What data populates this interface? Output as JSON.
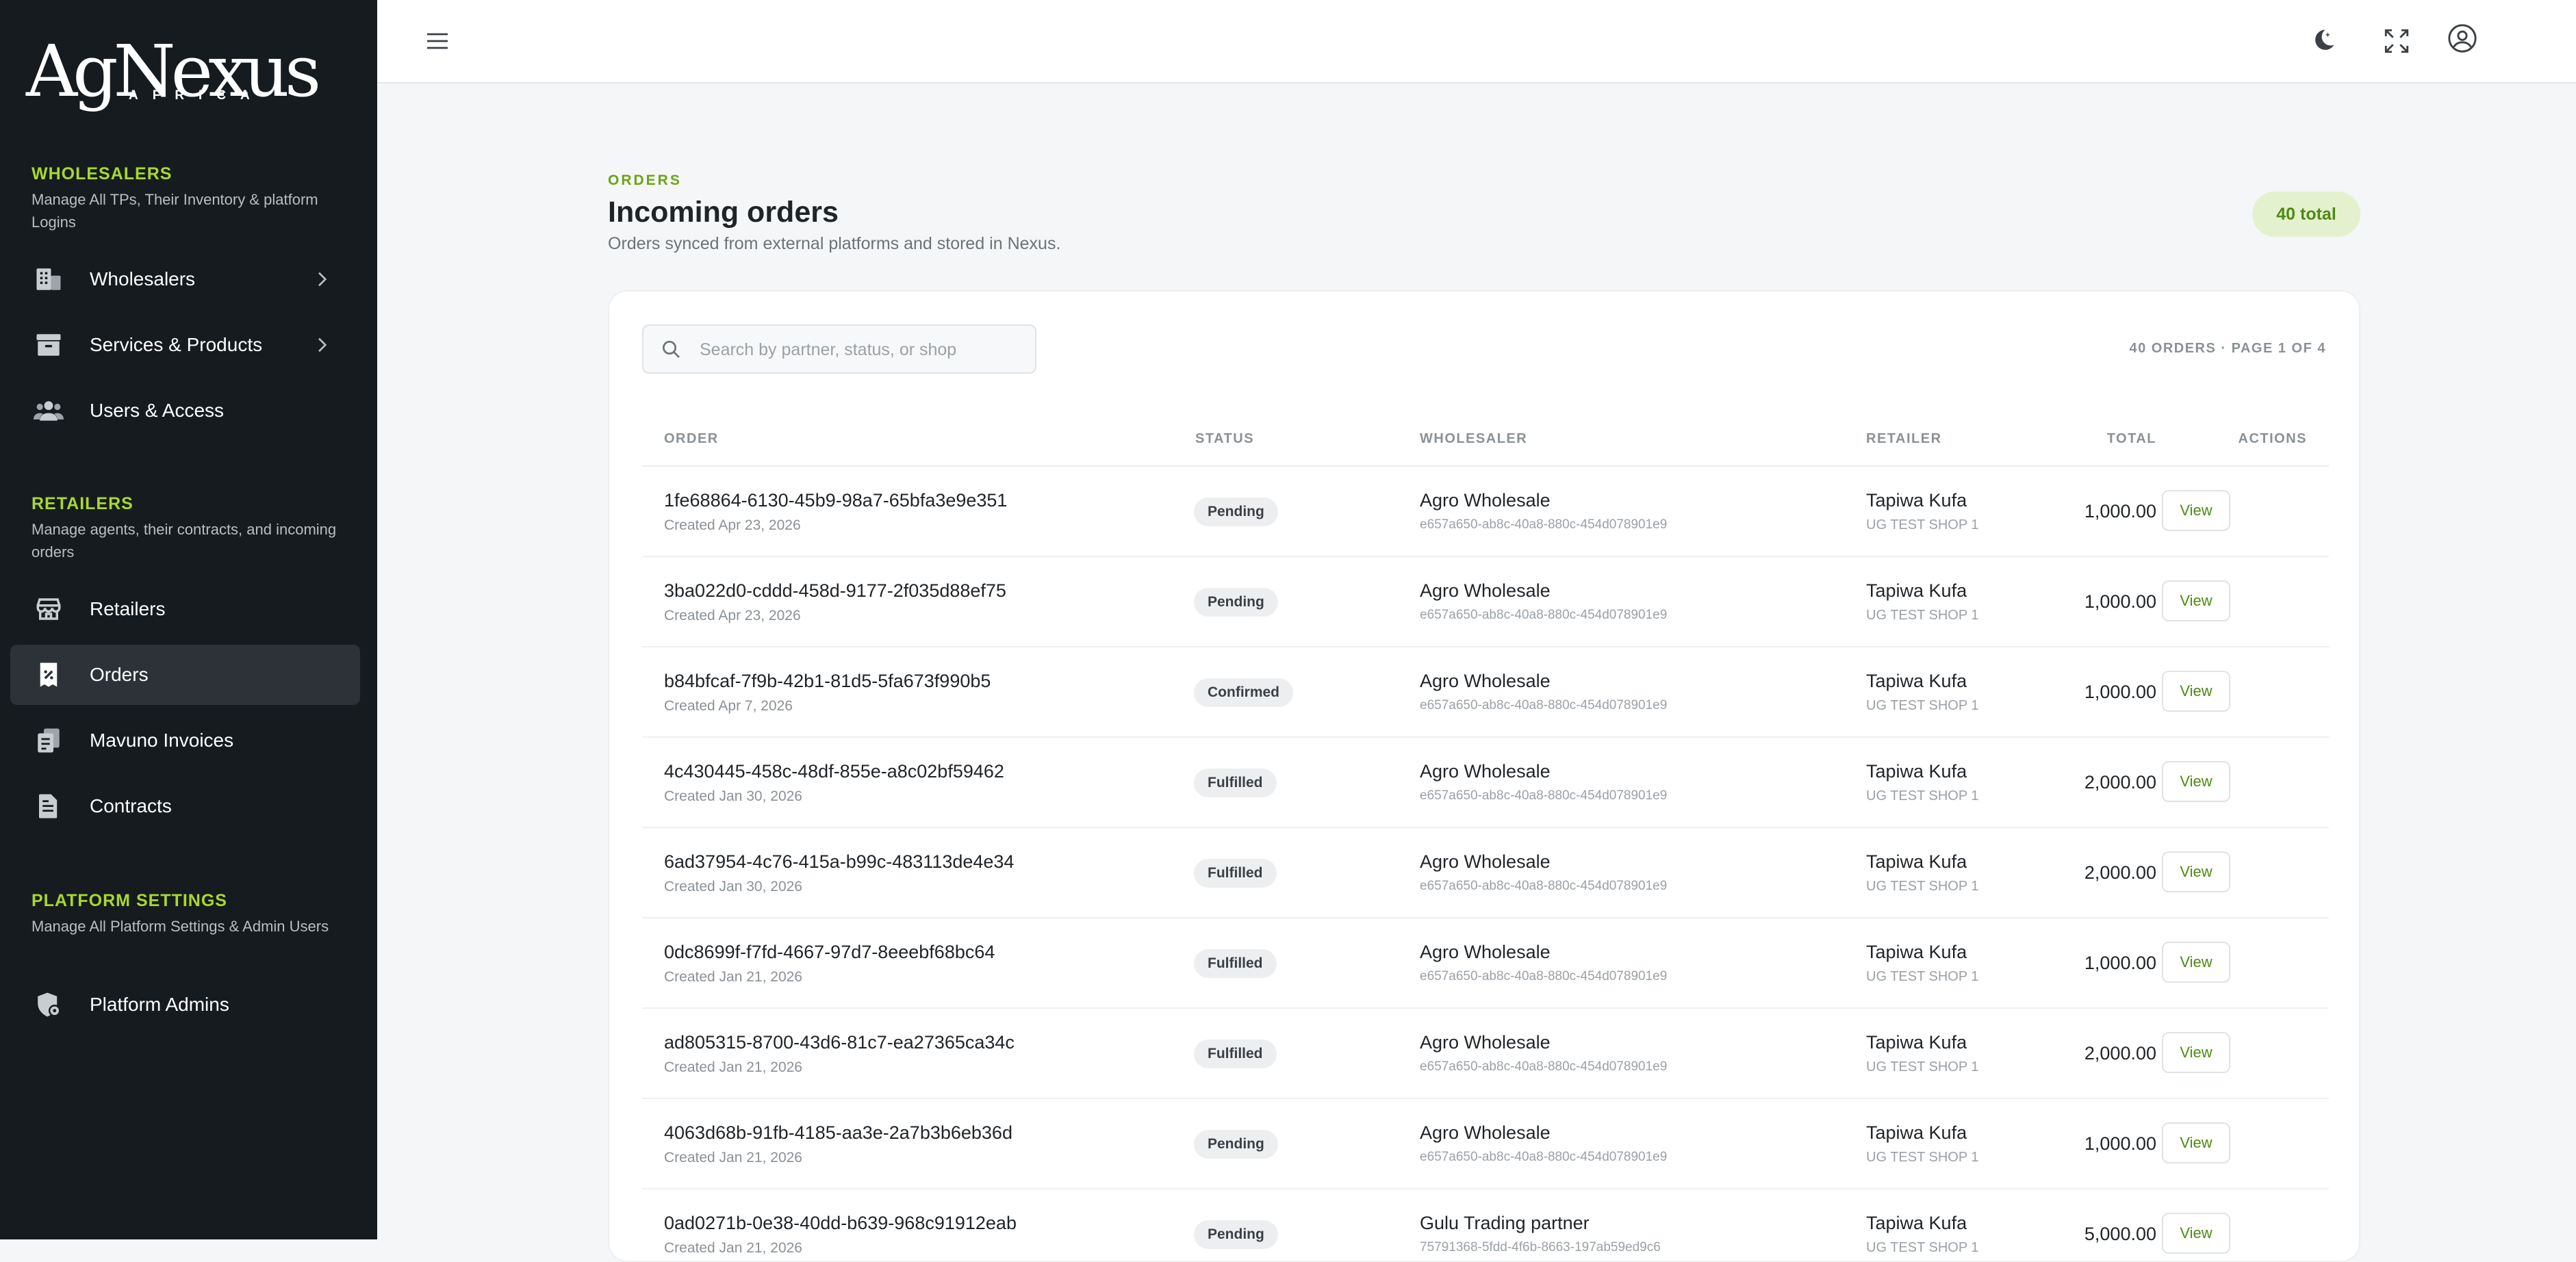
{
  "brand": {
    "name": "AgNexus",
    "sub": "AFRICA"
  },
  "sidebar": {
    "sections": [
      {
        "title": "WHOLESALERS",
        "desc": "Manage All TPs, Their Inventory & platform Logins"
      },
      {
        "title": "RETAILERS",
        "desc": "Manage agents, their contracts, and incoming orders"
      },
      {
        "title": "PLATFORM SETTINGS",
        "desc": "Manage All Platform Settings & Admin Users"
      }
    ],
    "items": [
      {
        "label": "Wholesalers",
        "icon": "building-icon"
      },
      {
        "label": "Services & Products",
        "icon": "archive-box-icon"
      },
      {
        "label": "Users & Access",
        "icon": "users-icon"
      },
      {
        "label": "Retailers",
        "icon": "storefront-icon"
      },
      {
        "label": "Orders",
        "icon": "receipt-percent-icon"
      },
      {
        "label": "Mavuno Invoices",
        "icon": "invoice-stack-icon"
      },
      {
        "label": "Contracts",
        "icon": "document-icon"
      },
      {
        "label": "Platform Admins",
        "icon": "shield-gear-icon"
      }
    ]
  },
  "topbar": {
    "menu_icon": "hamburger-icon",
    "theme_icon": "moon-icon",
    "fullscreen_icon": "expand-icon",
    "account_icon": "user-circle-icon"
  },
  "header": {
    "eyebrow": "ORDERS",
    "title": "Incoming orders",
    "subtitle": "Orders synced from external platforms and stored in Nexus.",
    "total_badge": "40 total"
  },
  "search": {
    "placeholder": "Search by partner, status, or shop",
    "value": ""
  },
  "pager": "40 ORDERS · PAGE 1 OF 4",
  "table": {
    "columns": [
      "ORDER",
      "STATUS",
      "WHOLESALER",
      "RETAILER",
      "TOTAL",
      "ACTIONS"
    ],
    "action_label": "View",
    "rows": [
      {
        "id": "1fe68864-6130-45b9-98a7-65bfa3e9e351",
        "created": "Created Apr 23, 2026",
        "status": "Pending",
        "wholesaler": "Agro Wholesale",
        "wholesaler_id": "e657a650-ab8c-40a8-880c-454d078901e9",
        "retailer": "Tapiwa Kufa",
        "shop": "UG TEST SHOP 1",
        "total": "1,000.00"
      },
      {
        "id": "3ba022d0-cddd-458d-9177-2f035d88ef75",
        "created": "Created Apr 23, 2026",
        "status": "Pending",
        "wholesaler": "Agro Wholesale",
        "wholesaler_id": "e657a650-ab8c-40a8-880c-454d078901e9",
        "retailer": "Tapiwa Kufa",
        "shop": "UG TEST SHOP 1",
        "total": "1,000.00"
      },
      {
        "id": "b84bfcaf-7f9b-42b1-81d5-5fa673f990b5",
        "created": "Created Apr 7, 2026",
        "status": "Confirmed",
        "wholesaler": "Agro Wholesale",
        "wholesaler_id": "e657a650-ab8c-40a8-880c-454d078901e9",
        "retailer": "Tapiwa Kufa",
        "shop": "UG TEST SHOP 1",
        "total": "1,000.00"
      },
      {
        "id": "4c430445-458c-48df-855e-a8c02bf59462",
        "created": "Created Jan 30, 2026",
        "status": "Fulfilled",
        "wholesaler": "Agro Wholesale",
        "wholesaler_id": "e657a650-ab8c-40a8-880c-454d078901e9",
        "retailer": "Tapiwa Kufa",
        "shop": "UG TEST SHOP 1",
        "total": "2,000.00"
      },
      {
        "id": "6ad37954-4c76-415a-b99c-483113de4e34",
        "created": "Created Jan 30, 2026",
        "status": "Fulfilled",
        "wholesaler": "Agro Wholesale",
        "wholesaler_id": "e657a650-ab8c-40a8-880c-454d078901e9",
        "retailer": "Tapiwa Kufa",
        "shop": "UG TEST SHOP 1",
        "total": "2,000.00"
      },
      {
        "id": "0dc8699f-f7fd-4667-97d7-8eeebf68bc64",
        "created": "Created Jan 21, 2026",
        "status": "Fulfilled",
        "wholesaler": "Agro Wholesale",
        "wholesaler_id": "e657a650-ab8c-40a8-880c-454d078901e9",
        "retailer": "Tapiwa Kufa",
        "shop": "UG TEST SHOP 1",
        "total": "1,000.00"
      },
      {
        "id": "ad805315-8700-43d6-81c7-ea27365ca34c",
        "created": "Created Jan 21, 2026",
        "status": "Fulfilled",
        "wholesaler": "Agro Wholesale",
        "wholesaler_id": "e657a650-ab8c-40a8-880c-454d078901e9",
        "retailer": "Tapiwa Kufa",
        "shop": "UG TEST SHOP 1",
        "total": "2,000.00"
      },
      {
        "id": "4063d68b-91fb-4185-aa3e-2a7b3b6eb36d",
        "created": "Created Jan 21, 2026",
        "status": "Pending",
        "wholesaler": "Agro Wholesale",
        "wholesaler_id": "e657a650-ab8c-40a8-880c-454d078901e9",
        "retailer": "Tapiwa Kufa",
        "shop": "UG TEST SHOP 1",
        "total": "1,000.00"
      },
      {
        "id": "0ad0271b-0e38-40dd-b639-968c91912eab",
        "created": "Created Jan 21, 2026",
        "status": "Pending",
        "wholesaler": "Gulu Trading partner",
        "wholesaler_id": "75791368-5fdd-4f6b-8663-197ab59ed9c6",
        "retailer": "Tapiwa Kufa",
        "shop": "UG TEST SHOP 1",
        "total": "5,000.00"
      }
    ]
  }
}
